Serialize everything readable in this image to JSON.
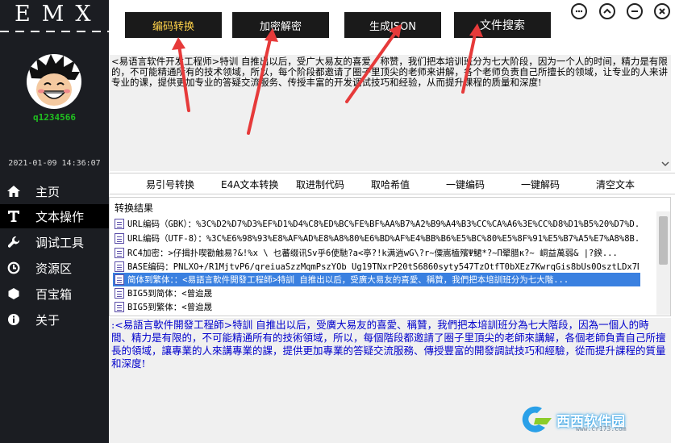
{
  "app": {
    "logo": "EMX"
  },
  "user": {
    "name": "q1234566",
    "datetime": "2021-01-09 14:36:07"
  },
  "nav": [
    {
      "label": "主页",
      "icon": "home-icon"
    },
    {
      "label": "文本操作",
      "icon": "text-icon",
      "active": true
    },
    {
      "label": "调试工具",
      "icon": "wrench-icon"
    },
    {
      "label": "资源区",
      "icon": "clock-icon"
    },
    {
      "label": "百宝箱",
      "icon": "hexagon-icon"
    },
    {
      "label": "关于",
      "icon": "info-icon"
    }
  ],
  "topbar": {
    "tabs": [
      {
        "label": "编码转换",
        "active": true
      },
      {
        "label": "加密解密"
      },
      {
        "label": "生成JSON"
      },
      {
        "label": "文件搜索"
      }
    ]
  },
  "input_text": "<易语言软件开发工程师>特训 自推出以后，受广大易友的喜爱，称赞，我们把本培训班分为七大阶段，因为一个人的时间，精力是有限的，不可能精通所有的技术领域，所以，每个阶段都邀请了圈子里顶尖的老师来讲解，各个老师负责自己所擅长的领域，让专业的人来讲专业的课，提供更加专业的答疑交流服务、传授丰富的开发调试技巧和经验，从而提升课程的质量和深度!",
  "actions": [
    "易引号转换",
    "E4A文本转换",
    "取进制代码",
    "取哈希值",
    "一键编码",
    "一键解码",
    "清空文本"
  ],
  "results": {
    "header": "转换结果",
    "rows": [
      "URL编码（GBK）：%3C%D2%D7%D3%EF%D1%D4%C8%ED%BC%FE%BF%AA%B7%A2%B9%A4%B3%CC%CA%A6%3E%CC%D8%D1%B5%20%D7%D...",
      "URL编码（UTF-8）：%3C%E6%98%93%E8%AF%AD%E8%A8%80%E6%BD%AF%E4%BB%B6%E5%BC%80%E5%8F%91%E5%B7%A5%E7%A8%8B...",
      "RC4加密：>仔揖扑喫勸触易?&!%x \\ 乜蕃缀讯Sv乎6使馳?a<亭?!k满逍wG\\?r~僳嵩榼殯Ψ鮶*?~Π翚腊κ?~ 峒益萬弱& |?鍨...",
      "BASE编码：PNLXO+/R1MjtvP6/qreiuaSzzMqmPszYOb Ug19TNxrP20tS6860syty547TzOtfT0bXEz7KwrqGis8bUs0OsztLDx7DR...",
      "简体到繁体：：<易語言軟件開發工程師>特訓 自推出以后，受廣大易友的喜愛、稱贊，我們把本培訓班分为七大階...",
      "BIG5到简体：<曾迨晟",
      "BIG5到繁体：<曾迨晟"
    ],
    "selected_index": 4
  },
  "output_text": ":<易語言軟件開發工程師>特訓 自推出以后，受廣大易友的喜愛、稱贊，我們把本培訓班分為七大階段，因為一個人的時間、精力是有限的，不可能精通所有的技術領域，所以，每個階段都邀請了圈子里頂尖的老師來講解，各個老師負責自己所擅長的領域，讓專業的人來講專業的課，提供更加專業的答疑交流服務、傳授豐富的開發調試技巧和經驗，從而提升課程的質量和深度!",
  "watermark": {
    "text": "西西软件园",
    "url": "www.cr173.com"
  },
  "colors": {
    "sidebar": "#1b1d22",
    "active_tab_text": "#ffd24a",
    "username": "#20c020",
    "output_text": "#0000cc",
    "selection": "#3a80e0",
    "arrow": "#e63a3a"
  }
}
